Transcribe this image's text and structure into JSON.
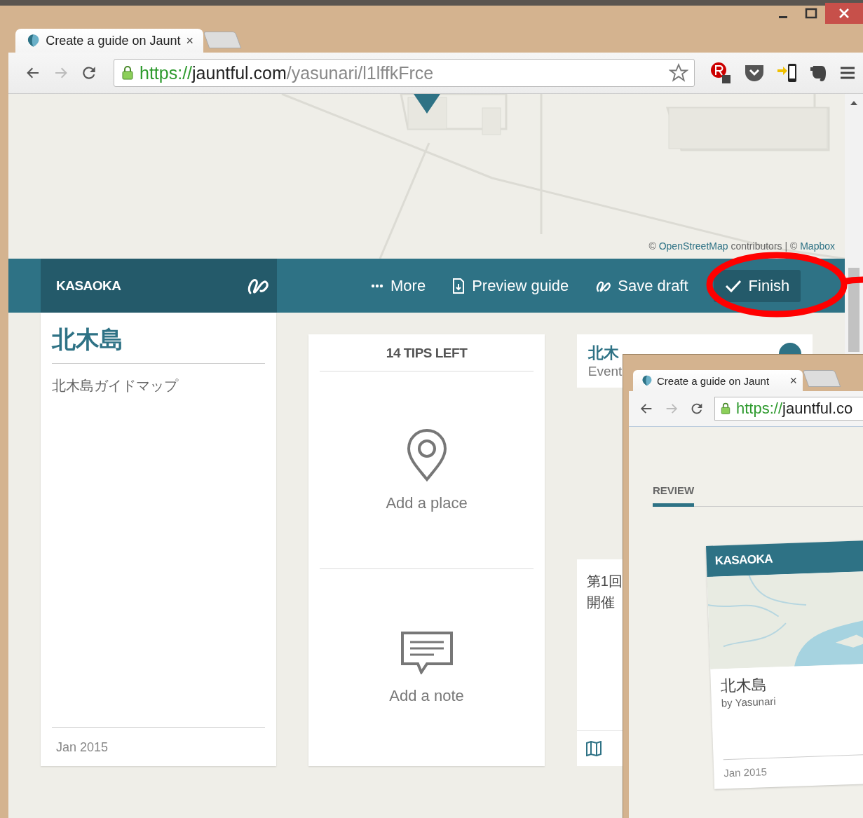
{
  "browser": {
    "tab_title": "Create a guide on Jaunt",
    "tab_close": "×",
    "url_scheme": "https://",
    "url_host": "jauntful.com",
    "url_path": "/yasunari/l1lffkFrce"
  },
  "map": {
    "attribution_prefix": "©",
    "link_1": "OpenStreetMap",
    "attribution_middle": "contributors | ©",
    "link_2": "Mapbox"
  },
  "toolbar": {
    "city": "KASAOKA",
    "actions": [
      {
        "kind": "more",
        "label": "More"
      },
      {
        "kind": "preview",
        "label": "Preview guide"
      },
      {
        "kind": "save",
        "label": "Save draft"
      },
      {
        "kind": "finish",
        "label": "Finish"
      }
    ]
  },
  "guide": {
    "title": "北木島",
    "description": "北木島ガイドマップ",
    "date": "Jan 2015"
  },
  "tips": {
    "heading": "14 TIPS LEFT",
    "options": [
      {
        "kind": "place",
        "label": "Add a place"
      },
      {
        "kind": "note",
        "label": "Add a note"
      }
    ]
  },
  "tip_card": {
    "title": "北木",
    "category": "Event",
    "body_lines": [
      "第1回",
      "開催"
    ]
  },
  "popup": {
    "tab_title": "Create a guide on Jaunt",
    "tab_close": "×",
    "url_scheme": "https://",
    "url_host": "jauntful.co",
    "section": "REVIEW",
    "card": {
      "city": "KASAOKA",
      "title": "北木島",
      "author": "by Yasunari",
      "date": "Jan 2015"
    }
  }
}
